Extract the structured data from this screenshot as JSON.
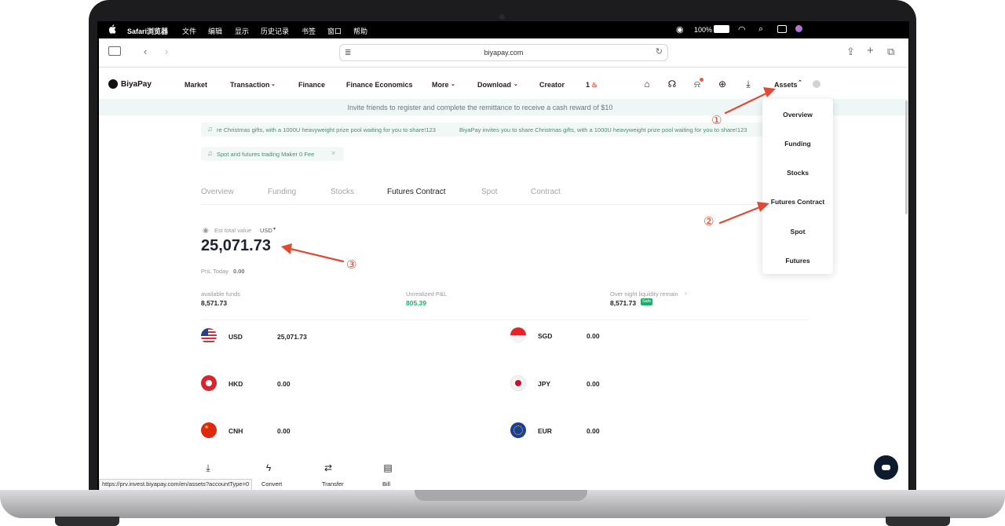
{
  "menubar": {
    "app": "Safari浏览器",
    "items": [
      "文件",
      "编辑",
      "显示",
      "历史记录",
      "书签",
      "窗口",
      "帮助"
    ],
    "battery": "100%"
  },
  "safari": {
    "url": "biyapay.com"
  },
  "nav": {
    "brand": "BiyaPay",
    "links": [
      "Market",
      "Transaction",
      "Finance",
      "Finance Economics",
      "More",
      "Download",
      "Creator",
      "1"
    ],
    "assets": "Assets"
  },
  "banner": "Invite friends to register and complete the remittance to receive a cash reward of $10",
  "notices": {
    "marquee_a": "re Christmas gifts, with a 1000U heavyweight prize pool waiting for you to share!123",
    "marquee_b": "BiyaPay invites you to share Christmas gifts, with a 1000U heavyweight prize pool waiting for you to share!123",
    "fee": "Spot and futures trading Maker 0 Fee"
  },
  "tabs": [
    "Overview",
    "Funding",
    "Stocks",
    "Futures Contract",
    "Spot",
    "Contract"
  ],
  "summary": {
    "est_label": "Est total value",
    "currency": "USD",
    "total": "25,071.73",
    "pnl_label": "PnL Today",
    "pnl_value": "0.00"
  },
  "funds": {
    "available_label": "available funds",
    "available_value": "8,571.73",
    "unrealized_label": "Unrealized P&L",
    "unrealized_value": "805.39",
    "overnight_label": "Over night liquidity remain",
    "overnight_value": "8,571.73",
    "safe_badge": "Safe"
  },
  "currencies": [
    {
      "code": "USD",
      "amount": "25,071.73"
    },
    {
      "code": "SGD",
      "amount": "0.00"
    },
    {
      "code": "HKD",
      "amount": "0.00"
    },
    {
      "code": "JPY",
      "amount": "0.00"
    },
    {
      "code": "CNH",
      "amount": "0.00"
    },
    {
      "code": "EUR",
      "amount": "0.00"
    }
  ],
  "actions": [
    "Convert",
    "Transfer",
    "Bill"
  ],
  "dropdown": [
    "Overview",
    "Funding",
    "Stocks",
    "Futures Contract",
    "Spot",
    "Futures"
  ],
  "annotations": [
    "①",
    "②",
    "③"
  ],
  "status_url": "https://prv.invest.biyapay.com/en/assets?accountType=0",
  "colors": {
    "accent_green": "#1fae6a",
    "annotation_red": "#e04a35",
    "banner_bg": "#eef6f6"
  }
}
